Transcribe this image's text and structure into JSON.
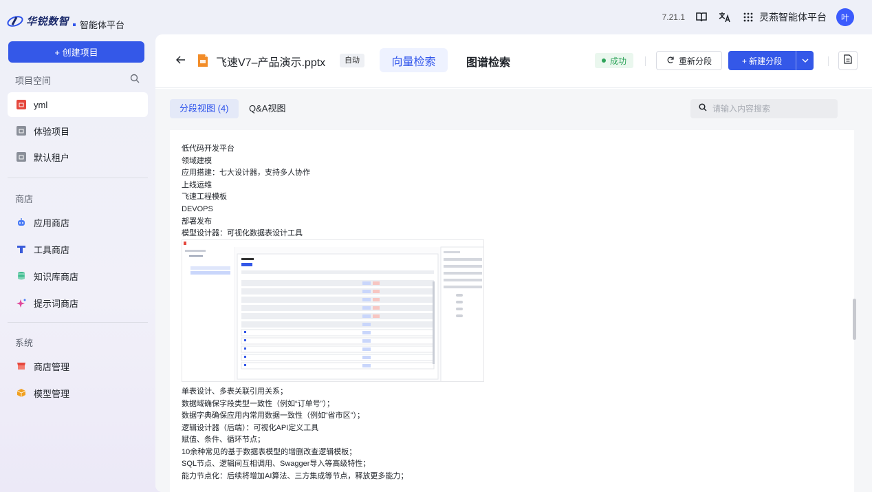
{
  "topbar": {
    "logo_brand": "华锐数智",
    "logo_sub": "智能体平台",
    "version": "7.21.1",
    "platform_name": "灵燕智能体平台",
    "avatar_text": "叶",
    "icons": [
      "book-icon",
      "translate-icon",
      "grid-apps-icon"
    ]
  },
  "sidebar": {
    "create_label": "+ 创建项目",
    "project_space_title": "项目空间",
    "projects": [
      {
        "label": "yml",
        "active": true,
        "icon_color": "#e5483e"
      },
      {
        "label": "体验项目",
        "active": false,
        "icon_color": "#8a8f99"
      },
      {
        "label": "默认租户",
        "active": false,
        "icon_color": "#8a8f99"
      }
    ],
    "store_title": "商店",
    "stores": [
      {
        "label": "应用商店",
        "icon": "robot-icon",
        "color": "#4a7cf6"
      },
      {
        "label": "工具商店",
        "icon": "tool-icon",
        "color": "#3a5bd9"
      },
      {
        "label": "知识库商店",
        "icon": "database-icon",
        "color": "#3dbb8f"
      },
      {
        "label": "提示词商店",
        "icon": "sparkle-icon",
        "color": "#e0489b"
      }
    ],
    "system_title": "系统",
    "system": [
      {
        "label": "商店管理",
        "icon": "store-icon",
        "color": "#e5483e"
      },
      {
        "label": "模型管理",
        "icon": "cube-icon",
        "color": "#f0a020"
      }
    ]
  },
  "header": {
    "file_name": "飞速V7–产品演示.pptx",
    "auto_tag": "自动",
    "tab_vector": "向量检索",
    "tab_graph": "图谱检索",
    "status": "成功",
    "reseg_label": "重新分段",
    "newseg_label": "+ 新建分段"
  },
  "subbar": {
    "seg_view": "分段视图 (4)",
    "qa_view": "Q&A视图",
    "search_placeholder": "请输入内容搜索"
  },
  "content": {
    "lines_top": [
      "低代码开发平台",
      "领域建模",
      "应用搭建：七大设计器，支持多人协作",
      "上线运维",
      "飞速工程模板",
      "DEVOPS",
      "部署发布",
      "模型设计器：可视化数据表设计工具"
    ],
    "lines_bottom": [
      "单表设计、多表关联引用关系；",
      "数据域确保字段类型一致性（例如“订单号”）；",
      "数据字典确保应用内常用数据一致性（例如“省市区”）；",
      "逻辑设计器（后端）：可视化API定义工具",
      "赋值、条件、循环节点；",
      "10余种常见的基于数据表模型的增删改查逻辑模板；",
      "SQL节点、逻辑间互相调用、Swagger导入等高级特性；",
      "能力节点化：后续将增加AI算法、三方集成等节点，释放更多能力；"
    ]
  },
  "colors": {
    "primary": "#3458e8",
    "success": "#2ea45a",
    "accent_text": "#2f54eb"
  }
}
